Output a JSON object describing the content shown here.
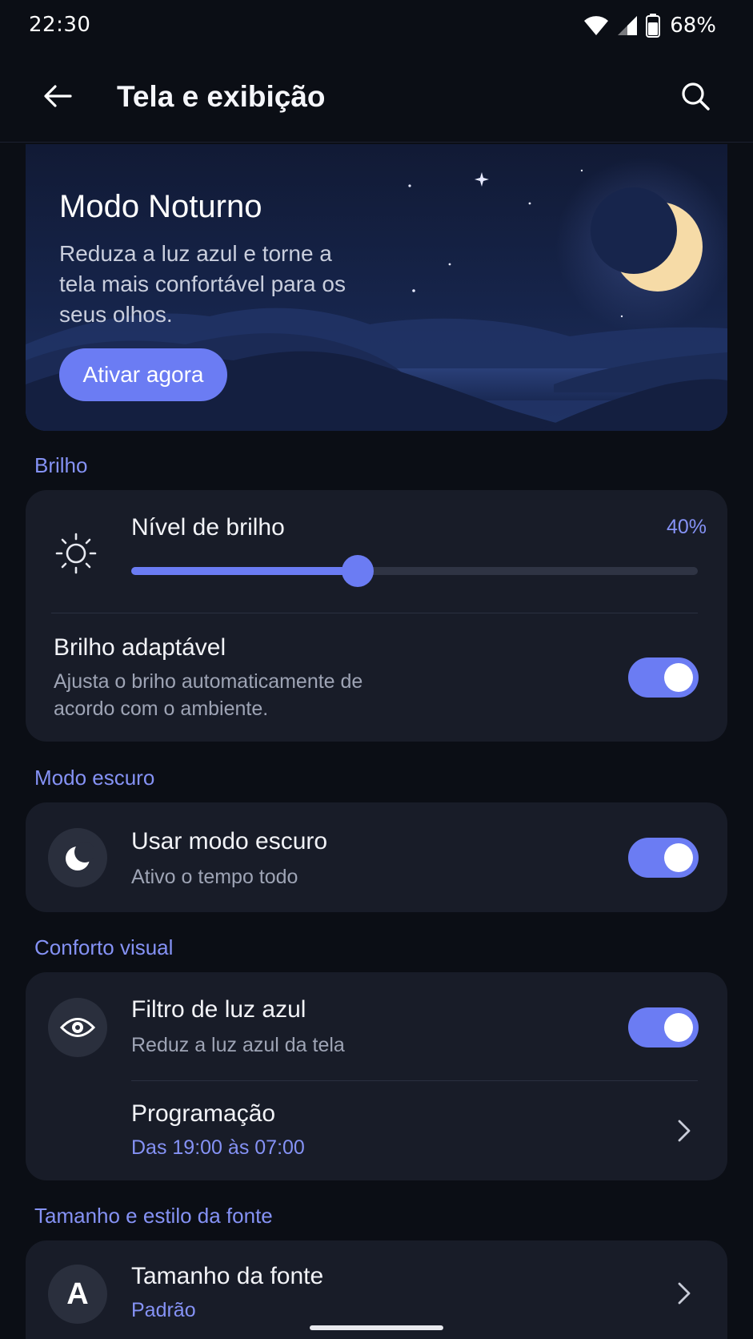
{
  "status_bar": {
    "time": "22:30",
    "battery_percent": "68%",
    "icons": [
      "wifi-icon",
      "signal-icon",
      "battery-icon"
    ]
  },
  "app_bar": {
    "title": "Tela e exibição",
    "back_icon": "arrow-left-icon",
    "search_icon": "search-icon"
  },
  "hero": {
    "title": "Modo Noturno",
    "description": "Reduza a luz azul e torne a tela mais confortável para os seus olhos.",
    "button_label": "Ativar agora",
    "illustration": "night-landscape-moon"
  },
  "sections": {
    "brightness": {
      "label": "Brilho",
      "level_title": "Nível de brilho",
      "level_value_text": "40%",
      "level_value": 0.4,
      "level_icon": "sun-icon",
      "adaptive_title": "Brilho adaptável",
      "adaptive_subtitle": "Ajusta o briho automaticamente de acordo com o ambiente.",
      "adaptive_enabled": true
    },
    "dark_mode": {
      "label": "Modo escuro",
      "title": "Usar modo escuro",
      "subtitle": "Ativo o tempo todo",
      "icon": "moon-icon",
      "enabled": true
    },
    "visual_comfort": {
      "label": "Conforto visual",
      "filter_title": "Filtro de luz azul",
      "filter_subtitle": "Reduz a luz azul da tela",
      "filter_icon": "eye-icon",
      "filter_enabled": true,
      "schedule_title": "Programação",
      "schedule_value": "Das 19:00 às 07:00"
    },
    "font": {
      "label": "Tamanho e estilo da fonte",
      "size_title": "Tamanho da fonte",
      "size_value": "Padrão",
      "icon_letter": "A"
    }
  },
  "colors": {
    "accent": "#6b7cf3",
    "accent_text": "#8592f5",
    "background": "#0b0e15",
    "card": "#181c28"
  }
}
